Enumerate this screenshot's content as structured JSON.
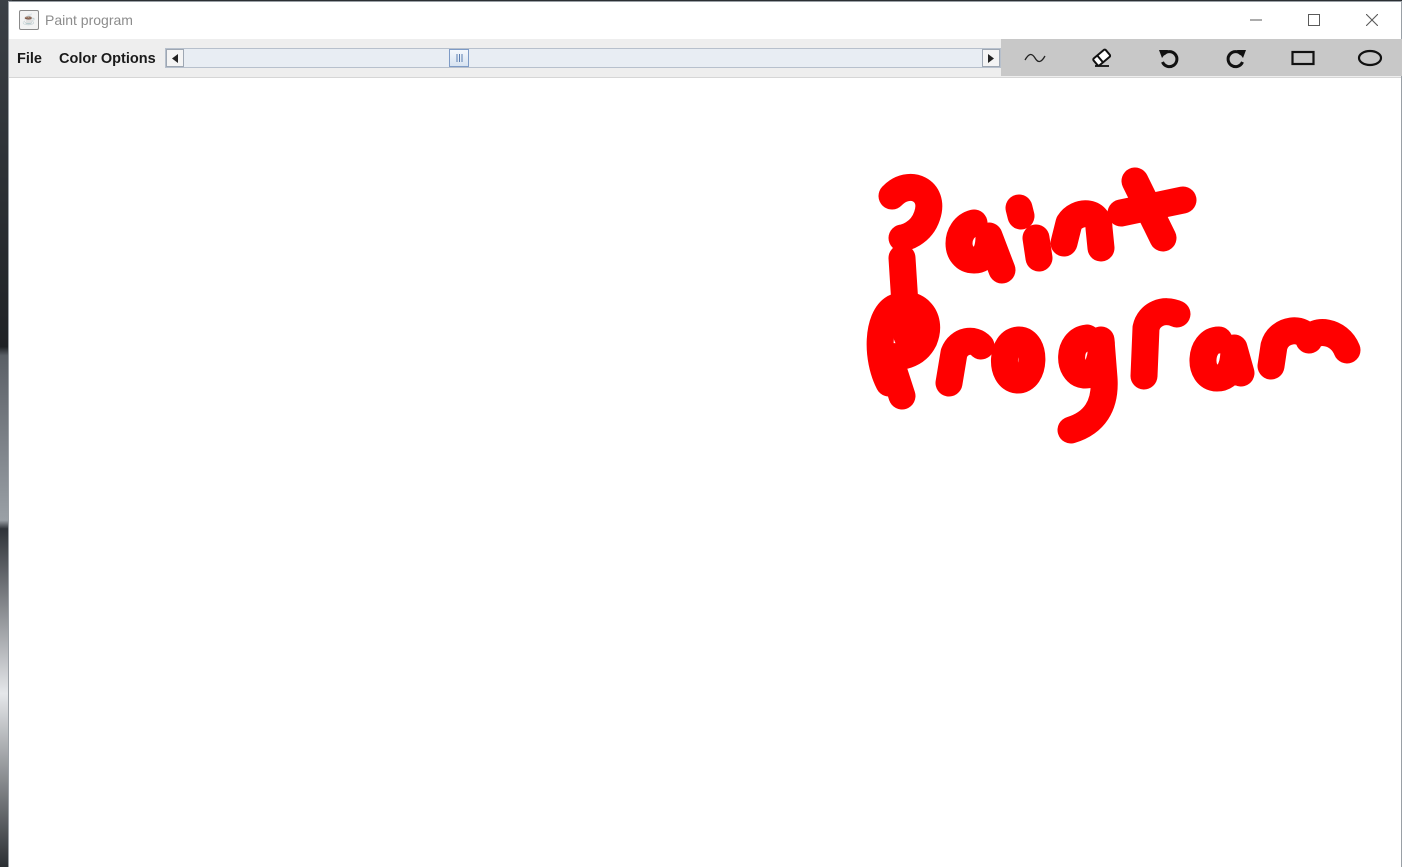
{
  "window": {
    "title": "Paint program",
    "controls": {
      "minimize_icon": "minimize-icon",
      "maximize_icon": "maximize-icon",
      "close_icon": "close-icon"
    }
  },
  "menubar": {
    "file_label": "File",
    "color_options_label": "Color Options"
  },
  "brush_size_slider": {
    "value_fraction": 0.34
  },
  "toolbar": {
    "tools": [
      {
        "name": "freehand",
        "icon": "freehand-icon"
      },
      {
        "name": "eraser",
        "icon": "eraser-icon"
      },
      {
        "name": "undo",
        "icon": "undo-icon"
      },
      {
        "name": "redo",
        "icon": "redo-icon"
      },
      {
        "name": "rectangle",
        "icon": "rectangle-icon"
      },
      {
        "name": "oval",
        "icon": "oval-icon"
      }
    ]
  },
  "canvas": {
    "drawing_text_line1": "Paint",
    "drawing_text_line2": "Program",
    "stroke_color": "#ff0000",
    "background_color": "#ffffff"
  }
}
